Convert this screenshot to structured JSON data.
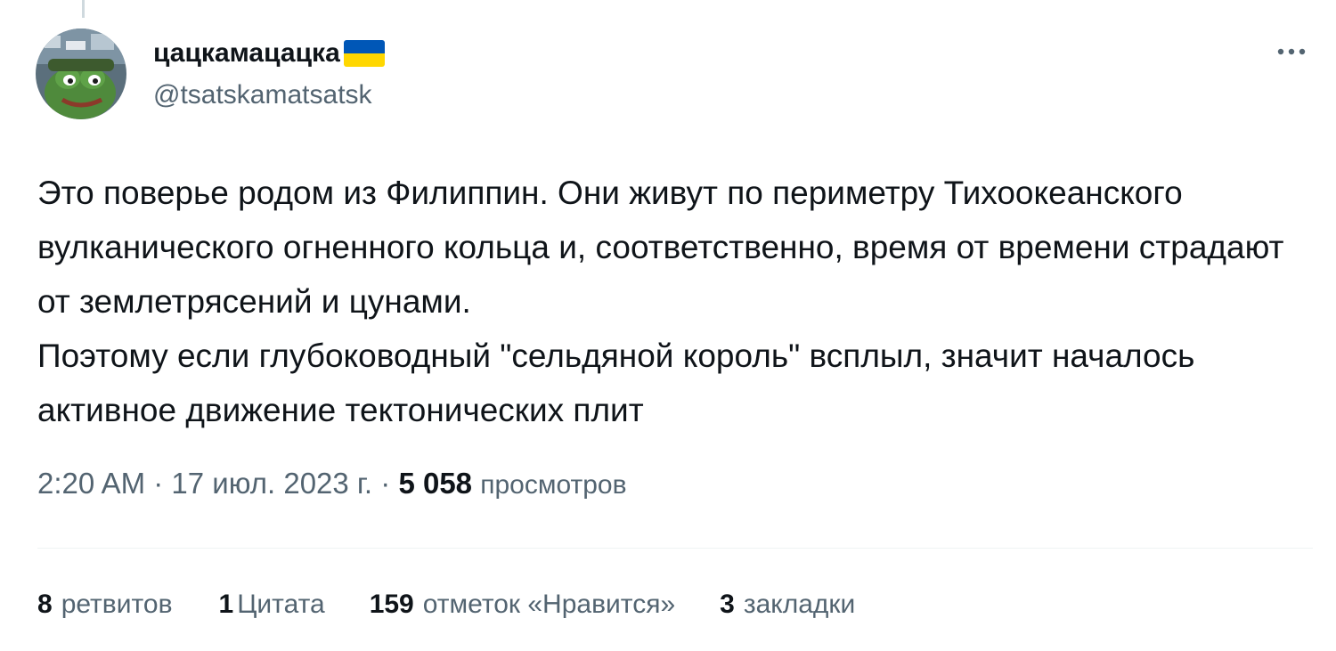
{
  "author": {
    "display_name": "цацкамацацка",
    "handle": "@tsatskamatsatsk",
    "avatar_icon": "frog-avatar-icon",
    "flag_icon": "ukraine-flag-icon"
  },
  "more_icon": "more-dots-icon",
  "tweet": {
    "paragraphs": [
      "Это поверье родом из Филиппин. Они живут по периметру Тихоокеанского вулканического огненного кольца и, соответственно, время от времени страдают от землетрясений и цунами.",
      "Поэтому если глубоководный \"сельдяной король\" всплыл, значит началось активное движение тектонических плит"
    ]
  },
  "meta": {
    "time": "2:20 AM",
    "separator": "·",
    "date": "17 июл. 2023 г.",
    "views_count": "5 058",
    "views_label": "просмотров"
  },
  "stats": {
    "retweets": {
      "count": "8",
      "label": "ретвитов"
    },
    "quotes": {
      "count": "1",
      "label": "Цитата"
    },
    "likes": {
      "count": "159",
      "label": "отметок «Нравится»"
    },
    "bookmarks": {
      "count": "3",
      "label": "закладки"
    }
  },
  "colors": {
    "text_primary": "#0f1419",
    "text_secondary": "#536471",
    "divider": "#eff3f4",
    "flag_blue": "#0057b7",
    "flag_yellow": "#ffd700"
  }
}
